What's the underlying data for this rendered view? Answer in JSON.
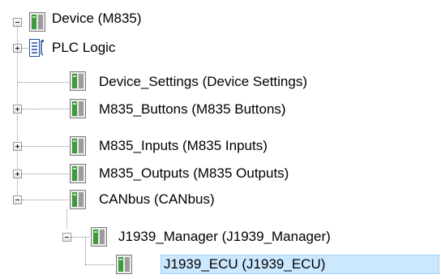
{
  "tree": {
    "nodes": [
      {
        "label": "Device (M835)",
        "icon": "device-module-icon",
        "expander": "collapse"
      },
      {
        "label": "PLC Logic",
        "icon": "plc-logic-icon",
        "expander": "expand"
      },
      {
        "label": "Device_Settings (Device Settings)",
        "icon": "device-module-icon",
        "expander": "none"
      },
      {
        "label": "M835_Buttons (M835 Buttons)",
        "icon": "device-module-icon",
        "expander": "expand"
      },
      {
        "label": "M835_Inputs (M835 Inputs)",
        "icon": "device-module-icon",
        "expander": "expand"
      },
      {
        "label": "M835_Outputs (M835 Outputs)",
        "icon": "device-module-icon",
        "expander": "expand"
      },
      {
        "label": "CANbus (CANbus)",
        "icon": "device-module-icon",
        "expander": "collapse"
      },
      {
        "label": "J1939_Manager (J1939_Manager)",
        "icon": "device-module-icon",
        "expander": "collapse"
      },
      {
        "label": "J1939_ECU (J1939_ECU)",
        "icon": "device-module-icon",
        "expander": "none",
        "selected": true
      }
    ]
  },
  "colors": {
    "selection_background": "#cce8ff",
    "selection_border": "#99d1ff",
    "module_icon_green": "#3e9b3c",
    "module_icon_gray": "#8a8a8a"
  }
}
